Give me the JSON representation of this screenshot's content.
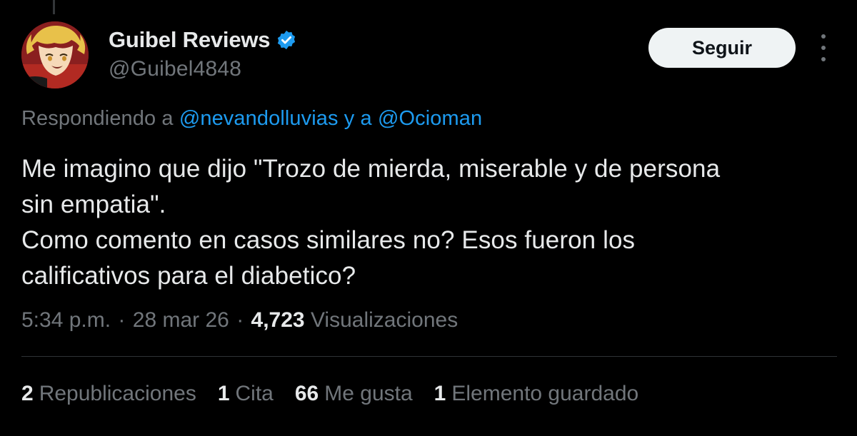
{
  "author": {
    "display_name": "Guibel Reviews",
    "handle": "@Guibel4848",
    "verified": true,
    "avatar_icon": "anime-character-avatar"
  },
  "actions": {
    "follow_label": "Seguir",
    "more_icon": "more-vertical-icon"
  },
  "reply_context": {
    "prefix": "Respondiendo a",
    "mention_1": "@nevandolluvias",
    "connector": "y a",
    "mention_2": "@Ocioman"
  },
  "tweet": {
    "lines": [
      "Me imagino que dijo \"Trozo de mierda, miserable y de persona",
      "sin empatia\".",
      "Como comento en casos similares no? Esos fueron los",
      "calificativos para el diabetico?"
    ]
  },
  "meta": {
    "time": "5:34 p.m.",
    "separator": "·",
    "date": "28 mar 26",
    "views_count": "4,723",
    "views_label": "Visualizaciones"
  },
  "stats": {
    "reposts_count": "2",
    "reposts_label": "Republicaciones",
    "quotes_count": "1",
    "quotes_label": "Cita",
    "likes_count": "66",
    "likes_label": "Me gusta",
    "bookmarks_count": "1",
    "bookmarks_label": "Elemento guardado"
  },
  "colors": {
    "background": "#000000",
    "text_primary": "#e7e9ea",
    "text_secondary": "#71767b",
    "link": "#1d9bf0",
    "verified": "#1d9bf0",
    "follow_bg": "#eff3f4",
    "divider": "#2f3336"
  }
}
